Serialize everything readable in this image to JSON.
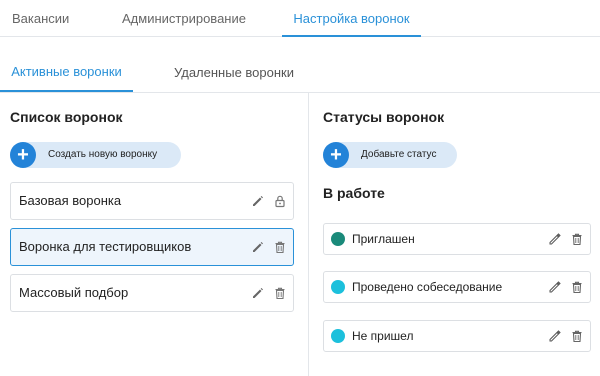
{
  "top_tabs": [
    {
      "label": "Вакансии",
      "active": false
    },
    {
      "label": "Администрирование",
      "active": false
    },
    {
      "label": "Настройка воронок",
      "active": true
    }
  ],
  "sub_tabs": [
    {
      "label": "Активные воронки",
      "active": true
    },
    {
      "label": "Удаленные воронки",
      "active": false
    }
  ],
  "funnels_panel": {
    "title": "Список воронок",
    "add_button_label": "Создать новую воронку",
    "items": [
      {
        "name": "Базовая воронка",
        "icons": [
          "pencil-icon",
          "lock-icon"
        ],
        "selected": false
      },
      {
        "name": "Воронка для тестировщиков",
        "icons": [
          "pencil-icon",
          "trash-icon"
        ],
        "selected": true
      },
      {
        "name": "Массовый подбор",
        "icons": [
          "pencil-icon",
          "trash-icon"
        ],
        "selected": false
      }
    ]
  },
  "statuses_panel": {
    "title": "Статусы воронок",
    "add_button_label": "Добавьте статус",
    "group_title": "В работе",
    "items": [
      {
        "name": "Приглашен",
        "color": "#1a8a7a"
      },
      {
        "name": "Проведено собеседование",
        "color": "#1cc0dc"
      },
      {
        "name": "Не пришел",
        "color": "#1cc0dc"
      }
    ]
  },
  "colors": {
    "accent": "#2a91d8",
    "add_button_bg": "#dbe9f7",
    "plus_circle": "#2383d8",
    "selected_row_bg": "#eef5fc"
  }
}
